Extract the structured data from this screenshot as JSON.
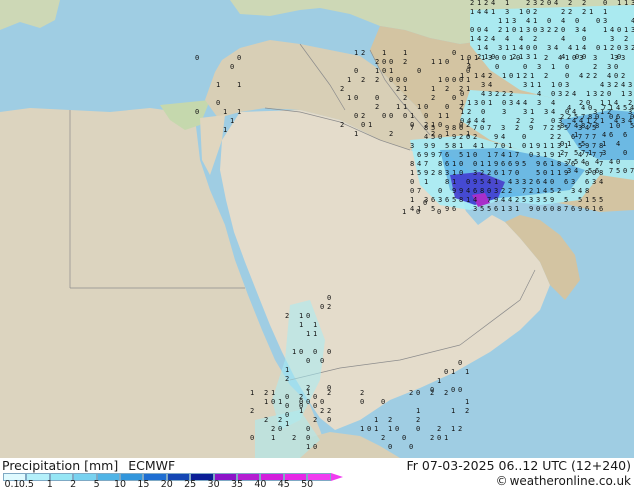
{
  "map": {
    "region": "Arabian Peninsula, Iran and Egypt",
    "model": "ECMWF",
    "colors": {
      "sea": "#9fcde3",
      "land": "#c7dcb1",
      "land_dry": "#dcd4bf",
      "mountain": "#d3c4a2",
      "desert": "#e4dccb",
      "border": "#8c8c8c",
      "precip_light": "#a6ecf6",
      "precip_mid": "#60b8ea",
      "precip_heavy": "#3c3cd2",
      "precip_extreme": "#aa1ec8"
    },
    "precip_value_glyphs": [
      "0",
      "1",
      "2",
      "3",
      "4",
      "5",
      "6",
      "7",
      "8",
      "9"
    ]
  },
  "footer": {
    "title_main": "Precipitation [mm]",
    "model_name": "ECMWF",
    "valid_time": "Fr 07-03-2025 06..12 UTC (12+240)",
    "copyright_symbol": "©",
    "site": "weatheronline.co.uk"
  },
  "colorbar": {
    "classes": [
      {
        "label": "0.1",
        "color": "#dffaff"
      },
      {
        "label": "0.5",
        "color": "#b4f0fa"
      },
      {
        "label": "1",
        "color": "#96e6f5"
      },
      {
        "label": "2",
        "color": "#78d2f0"
      },
      {
        "label": "5",
        "color": "#50b4e6"
      },
      {
        "label": "10",
        "color": "#3296dc"
      },
      {
        "label": "15",
        "color": "#1e6ed2"
      },
      {
        "label": "20",
        "color": "#1446b4"
      },
      {
        "label": "25",
        "color": "#0a1e96"
      },
      {
        "label": "30",
        "color": "#8c14c8"
      },
      {
        "label": "35",
        "color": "#b41ed2"
      },
      {
        "label": "40",
        "color": "#d21edc"
      },
      {
        "label": "45",
        "color": "#e628e6"
      },
      {
        "label": "50",
        "color": "#f03cf0"
      }
    ]
  }
}
